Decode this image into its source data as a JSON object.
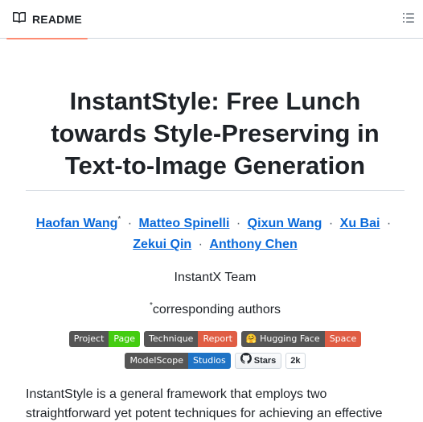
{
  "tab": {
    "label": "README",
    "icon": "book-icon"
  },
  "toc": {
    "icon": "list-icon"
  },
  "title": "InstantStyle: Free Lunch towards Style-Preserving in Text-to-Image Generation",
  "authors": [
    {
      "name": "Haofan Wang",
      "mark": "*"
    },
    {
      "name": "Matteo Spinelli",
      "mark": ""
    },
    {
      "name": "Qixun Wang",
      "mark": ""
    },
    {
      "name": "Xu Bai",
      "mark": ""
    },
    {
      "name": "Zekui Qin",
      "mark": ""
    },
    {
      "name": "Anthony Chen",
      "mark": ""
    }
  ],
  "separator": "·",
  "team": "InstantX Team",
  "note_mark": "*",
  "note": "corresponding authors",
  "badges": {
    "project": {
      "left": "Project",
      "right": "Page",
      "color": "#44cc11"
    },
    "technique": {
      "left": "Technique",
      "right": "Report",
      "color": "#e05d44"
    },
    "hf": {
      "left": "🤗 Hugging Face",
      "right": "Space",
      "color": "#e05d44"
    },
    "modelscope": {
      "left": "ModelScope",
      "right": "Studios",
      "color": "#1f73c5"
    },
    "stars": {
      "label": "Stars",
      "count": "2k",
      "icon": "github-icon"
    }
  },
  "paragraph": "InstantStyle is a general framework that employs two straightforward yet potent techniques for achieving an effective disentanglement of style and content from reference images."
}
